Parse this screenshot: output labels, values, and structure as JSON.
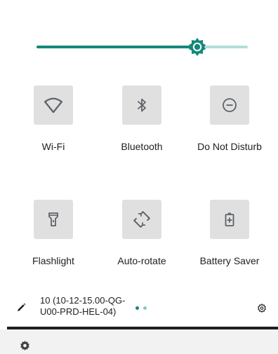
{
  "brightness": {
    "level": 0.76,
    "accent_color": "#148979",
    "track_color": "#b2dfdb"
  },
  "tiles": [
    {
      "label": "Wi-Fi",
      "icon": "wifi-icon"
    },
    {
      "label": "Bluetooth",
      "icon": "bluetooth-icon"
    },
    {
      "label": "Do Not Disturb",
      "icon": "do-not-disturb-icon"
    },
    {
      "label": "Flashlight",
      "icon": "flashlight-icon"
    },
    {
      "label": "Auto-rotate",
      "icon": "auto-rotate-icon"
    },
    {
      "label": "Battery Saver",
      "icon": "battery-saver-icon"
    }
  ],
  "footer": {
    "build_number": "10 (10-12-15.00-QG-U00-PRD-HEL-04)",
    "page_indicator": {
      "pages": 2,
      "active": 0,
      "active_color": "#148979",
      "inactive_color": "#80cbc4"
    }
  },
  "colors": {
    "tile_background": "#e0e0e0",
    "icon": "#5f6368"
  }
}
